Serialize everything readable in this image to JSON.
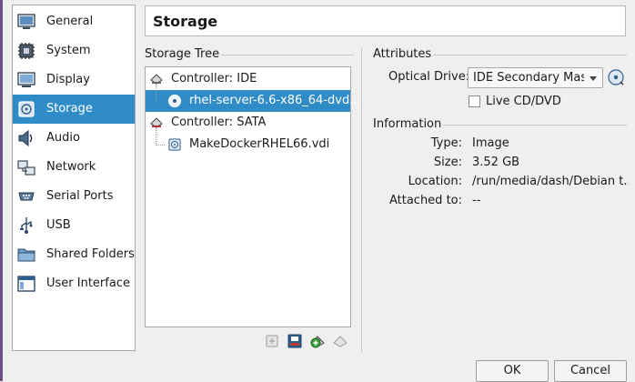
{
  "sidebar": {
    "items": [
      {
        "label": "General",
        "icon": "general-icon"
      },
      {
        "label": "System",
        "icon": "system-icon"
      },
      {
        "label": "Display",
        "icon": "display-icon"
      },
      {
        "label": "Storage",
        "icon": "storage-icon",
        "active": true
      },
      {
        "label": "Audio",
        "icon": "audio-icon"
      },
      {
        "label": "Network",
        "icon": "network-icon"
      },
      {
        "label": "Serial Ports",
        "icon": "serial-ports-icon"
      },
      {
        "label": "USB",
        "icon": "usb-icon"
      },
      {
        "label": "Shared Folders",
        "icon": "shared-folders-icon"
      },
      {
        "label": "User Interface",
        "icon": "user-interface-icon"
      }
    ]
  },
  "page": {
    "title": "Storage"
  },
  "storage_tree": {
    "header": "Storage Tree",
    "controllers": [
      {
        "label": "Controller: IDE",
        "attachments": [
          {
            "label": "rhel-server-6.6-x86_64-dvd...",
            "type": "optical",
            "selected": true
          }
        ]
      },
      {
        "label": "Controller: SATA",
        "attachments": [
          {
            "label": "MakeDockerRHEL66.vdi",
            "type": "hard-disk"
          }
        ]
      }
    ],
    "tools": [
      "add-attachment-icon",
      "remove-attachment-icon",
      "add-controller-icon",
      "remove-controller-icon"
    ]
  },
  "attributes": {
    "header": "Attributes",
    "optical_drive_label": "Optical Drive:",
    "optical_drive_value": "IDE Secondary Master",
    "live_cd_label": "Live CD/DVD",
    "live_cd_checked": false
  },
  "information": {
    "header": "Information",
    "rows": [
      {
        "key": "Type:",
        "value": "Image"
      },
      {
        "key": "Size:",
        "value": "3.52 GB"
      },
      {
        "key": "Location:",
        "value": "/run/media/dash/Debian t..."
      },
      {
        "key": "Attached to:",
        "value": "--"
      }
    ]
  },
  "buttons": {
    "ok": "OK",
    "cancel": "Cancel"
  },
  "colors": {
    "accent": "#308cc6",
    "window_bg": "#efefef"
  }
}
